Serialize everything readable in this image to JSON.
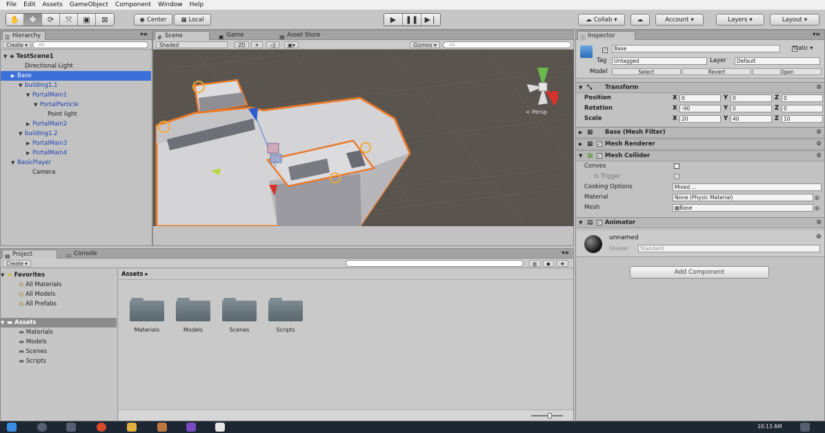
{
  "menu": [
    "File",
    "Edit",
    "Assets",
    "GameObject",
    "Component",
    "Window",
    "Help"
  ],
  "toolbar": {
    "tools": [
      "hand",
      "move",
      "rotate",
      "scale",
      "rect",
      "custom"
    ],
    "pivot_label": "Center",
    "space_label": "Local",
    "collab_label": "Collab",
    "account_label": "Account",
    "layers_label": "Layers",
    "layout_label": "Layout"
  },
  "hierarchy": {
    "tab": "Hierarchy",
    "create": "Create",
    "search_placeholder": "All",
    "rows": [
      {
        "label": "TestScene1",
        "indent": 0,
        "arrow": "▼",
        "style": "scene"
      },
      {
        "label": "Directional Light",
        "indent": 2,
        "arrow": "",
        "style": "plain"
      },
      {
        "label": "Base",
        "indent": 1,
        "arrow": "▶",
        "style": "selected"
      },
      {
        "label": "building1.1",
        "indent": 2,
        "arrow": "▼",
        "style": "blue"
      },
      {
        "label": "PortalMain1",
        "indent": 3,
        "arrow": "▼",
        "style": "blue"
      },
      {
        "label": "PortalParticle",
        "indent": 4,
        "arrow": "▼",
        "style": "blue"
      },
      {
        "label": "Point light",
        "indent": 5,
        "arrow": "",
        "style": "plain"
      },
      {
        "label": "PortalMain2",
        "indent": 3,
        "arrow": "▶",
        "style": "blue"
      },
      {
        "label": "building1.2",
        "indent": 2,
        "arrow": "▼",
        "style": "blue"
      },
      {
        "label": "PortalMain3",
        "indent": 3,
        "arrow": "▶",
        "style": "blue"
      },
      {
        "label": "PortalMain4",
        "indent": 3,
        "arrow": "▶",
        "style": "blue"
      },
      {
        "label": "BasicPlayer",
        "indent": 1,
        "arrow": "▼",
        "style": "blue"
      },
      {
        "label": "Camera",
        "indent": 3,
        "arrow": "",
        "style": "plain"
      }
    ]
  },
  "scene": {
    "tabs": [
      "Scene",
      "Game",
      "Asset Store"
    ],
    "shading": "Shaded",
    "mode_2d": "2D",
    "gizmos": "Gizmos",
    "search_placeholder": "All",
    "persp_label": "< Persp"
  },
  "inspector": {
    "tab": "Inspector",
    "object_name": "Base",
    "static_label": "Static",
    "tag_label": "Tag",
    "tag_value": "Untagged",
    "layer_label": "Layer",
    "layer_value": "Default",
    "model_label": "Model",
    "model_buttons": [
      "Select",
      "Revert",
      "Open"
    ],
    "transform": {
      "title": "Transform",
      "rows": [
        {
          "label": "Position",
          "x": "0",
          "y": "0",
          "z": "0"
        },
        {
          "label": "Rotation",
          "x": "-90",
          "y": "0",
          "z": "0"
        },
        {
          "label": "Scale",
          "x": "20",
          "y": "40",
          "z": "10"
        }
      ]
    },
    "components": [
      "Base (Mesh Filter)",
      "Mesh Renderer",
      "Mesh Collider"
    ],
    "collider": {
      "convex": "Convex",
      "is_trigger": "Is Trigger",
      "cooking_label": "Cooking Options",
      "cooking_value": "Mixed ...",
      "material_label": "Material",
      "material_value": "None (Physic Material)",
      "mesh_label": "Mesh",
      "mesh_value": "Base"
    },
    "animator": "Animator",
    "material_name": "unnamed",
    "shader_label": "Shader",
    "shader_value": "Standard",
    "add_component": "Add Component"
  },
  "project": {
    "tabs": [
      "Project",
      "Console"
    ],
    "create": "Create",
    "favorites_label": "Favorites",
    "favorites": [
      "All Materials",
      "All Models",
      "All Prefabs"
    ],
    "assets_label": "Assets",
    "asset_tree": [
      "Materials",
      "Models",
      "Scenes",
      "Scripts"
    ],
    "breadcrumb": "Assets",
    "folders": [
      "Materials",
      "Models",
      "Scenes",
      "Scripts"
    ]
  },
  "taskbar": {
    "time": "10:13 AM"
  },
  "colors": {
    "selection": "#3c70d8",
    "scene_bg": "#5a544f",
    "outline": "#e87a2c"
  }
}
